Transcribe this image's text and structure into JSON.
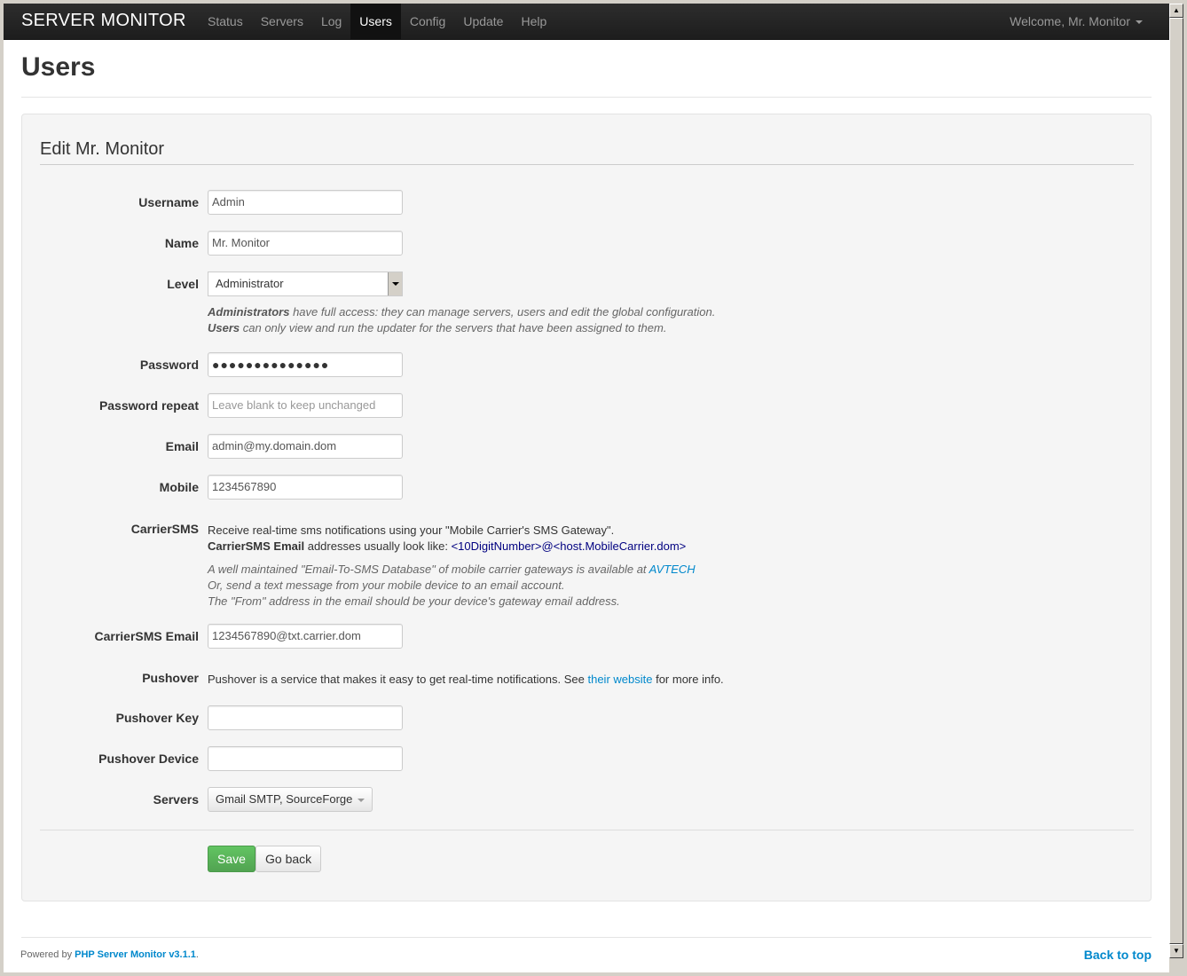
{
  "navbar": {
    "brand": "SERVER MONITOR",
    "items": [
      {
        "label": "Status"
      },
      {
        "label": "Servers"
      },
      {
        "label": "Log"
      },
      {
        "label": "Users"
      },
      {
        "label": "Config"
      },
      {
        "label": "Update"
      },
      {
        "label": "Help"
      }
    ],
    "active": "Users",
    "welcome": "Welcome, Mr. Monitor"
  },
  "page": {
    "title": "Users"
  },
  "form": {
    "legend": "Edit Mr. Monitor",
    "username": {
      "label": "Username",
      "value": "Admin"
    },
    "name": {
      "label": "Name",
      "value": "Mr. Monitor"
    },
    "level": {
      "label": "Level",
      "value": "Administrator",
      "help_admin_strong": "Administrators",
      "help_admin_text": " have full access: they can manage servers, users and edit the global configuration.",
      "help_user_strong": "Users",
      "help_user_text": " can only view and run the updater for the servers that have been assigned to them."
    },
    "password": {
      "label": "Password",
      "value": "●●●●●●●●●●●●●●"
    },
    "password_repeat": {
      "label": "Password repeat",
      "placeholder": "Leave blank to keep unchanged"
    },
    "email": {
      "label": "Email",
      "value": "admin@my.domain.dom"
    },
    "mobile": {
      "label": "Mobile",
      "value": "1234567890"
    },
    "carriersms": {
      "label": "CarrierSMS",
      "line1": "Receive real-time sms notifications using your \"Mobile Carrier's SMS Gateway\".",
      "line2_strong": "CarrierSMS Email",
      "line2_text": " addresses usually look like: ",
      "line2_example": "<10DigitNumber>@<host.MobileCarrier.dom>",
      "help1_text": "A well maintained \"Email-To-SMS Database\" of mobile carrier gateways is available at ",
      "help1_link": "AVTECH",
      "help2": "Or, send a text message from your mobile device to an email account.",
      "help3": "The \"From\" address in the email should be your device's gateway email address."
    },
    "carriersms_email": {
      "label": "CarrierSMS Email",
      "value": "1234567890@txt.carrier.dom"
    },
    "pushover": {
      "label": "Pushover",
      "text_before": "Pushover is a service that makes it easy to get real-time notifications. See ",
      "link": "their website",
      "text_after": " for more info."
    },
    "pushover_key": {
      "label": "Pushover Key",
      "value": ""
    },
    "pushover_device": {
      "label": "Pushover Device",
      "value": ""
    },
    "servers": {
      "label": "Servers",
      "value": "Gmail SMTP, SourceForge"
    },
    "save_label": "Save",
    "back_label": "Go back"
  },
  "footer": {
    "powered_by": "Powered by ",
    "product": "PHP Server Monitor v3.1.1",
    "period": ".",
    "back_to_top": "Back to top"
  }
}
